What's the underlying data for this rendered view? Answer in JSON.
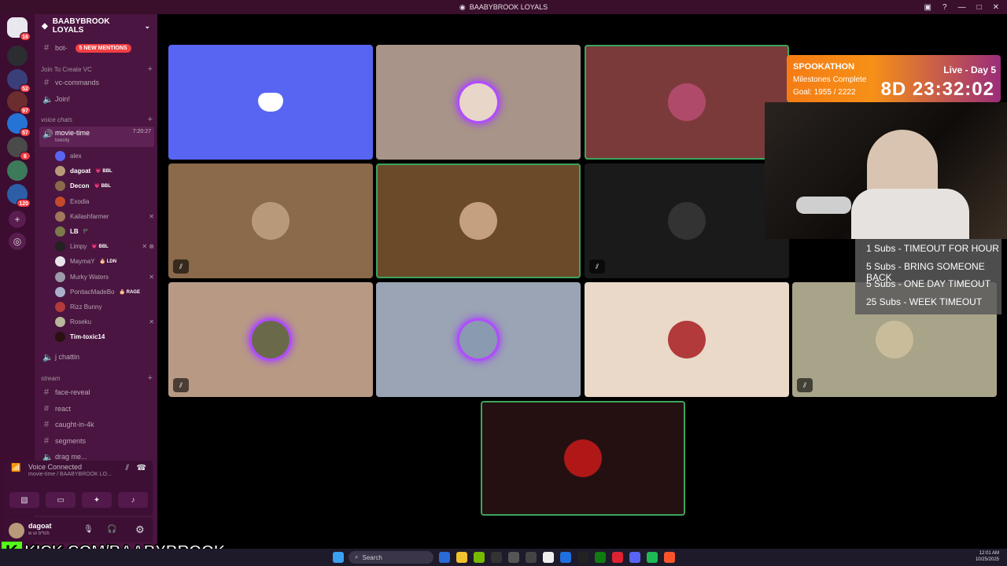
{
  "window": {
    "title": "BAABYBROOK LOYALS"
  },
  "rail": {
    "servers": [
      {
        "badge": "16",
        "color": "#e8e8ee"
      },
      {
        "badge": "",
        "color": "#2b2d31"
      },
      {
        "badge": "52",
        "color": "#3a3f7a"
      },
      {
        "badge": "97",
        "color": "#6b2d2d"
      },
      {
        "badge": "57",
        "color": "#2673d6"
      },
      {
        "badge": "6",
        "color": "#4a4a4a"
      },
      {
        "badge": "",
        "color": "#3c7a5a"
      },
      {
        "badge": "120",
        "color": "#2c5fa8"
      }
    ]
  },
  "sidebar": {
    "server_name": "BAABYBROOK LOYALS",
    "bot_channel": "bot-",
    "mentions": "5 NEW MENTIONS",
    "cat_create": "Join To Create VC",
    "vc_commands": "vc-commands",
    "join": "Join!",
    "cat_voice": "voice chats",
    "movie_time": "movie-time",
    "movie_time_timer": "7:20:27",
    "movie_time_sub": "toxicity",
    "users": [
      {
        "name": "alex",
        "tag": "",
        "muted": "",
        "color": "#5865f2"
      },
      {
        "name": "dagoat",
        "tag": "💗 BBL",
        "muted": "",
        "color": "#b89a7a"
      },
      {
        "name": "Decon",
        "tag": "💗 BBL",
        "muted": "",
        "color": "#8a6a4a"
      },
      {
        "name": "Exodia",
        "tag": "",
        "muted": "",
        "color": "#c44a2a"
      },
      {
        "name": "Kailashfarmer",
        "tag": "",
        "muted": "✕",
        "color": "#a0785a"
      },
      {
        "name": "LB",
        "tag": "🏴",
        "muted": "",
        "color": "#7a7a4a"
      },
      {
        "name": "Limpy",
        "tag": "💗 BBL",
        "muted": "✕ ⊗",
        "color": "#222222"
      },
      {
        "name": "MaymaY",
        "tag": "🎂 LDN",
        "muted": "",
        "color": "#e9e4ea"
      },
      {
        "name": "Murky Waters",
        "tag": "",
        "muted": "✕",
        "color": "#9a9aaa"
      },
      {
        "name": "PontiacMadeBo",
        "tag": "🎂 RAGE",
        "muted": "",
        "color": "#aab0c8"
      },
      {
        "name": "Rizz Bunny",
        "tag": "",
        "muted": "",
        "color": "#b23a3a"
      },
      {
        "name": "Roseku",
        "tag": "",
        "muted": "✕",
        "color": "#b8b89a"
      },
      {
        "name": "Tim-toxic14",
        "tag": "",
        "muted": "",
        "color": "#2a1010"
      }
    ],
    "j_chattin": "j chattin",
    "cat_stream": "stream",
    "stream_channels": [
      "face-reveal",
      "react",
      "caught-in-4k",
      "segments",
      "drag me..."
    ]
  },
  "voice_panel": {
    "status": "Voice Connected",
    "channel": "movie-time / BAABYBROOK LO..."
  },
  "user_panel": {
    "name": "dagoat",
    "status": "w ur b*tch"
  },
  "overlay_kick": {
    "url": "KICK.COM/BAABYBROOK"
  },
  "spookathon": {
    "title": "SPOOKATHON",
    "milestones": "Milestones Complete",
    "goal": "Goal: 1955 / 2222",
    "live": "Live - Day 5",
    "timer": "8D 23:32:02"
  },
  "subs_list": [
    "1 Subs - TIMEOUT FOR HOUR",
    "5 Subs - BRING SOMEONE BACK",
    "5 Subs - ONE DAY TIMEOUT",
    "25 Subs - WEEK TIMEOUT"
  ],
  "tiles": [
    {
      "bg": "#5865f2",
      "avatar": "discord",
      "speaking": false,
      "muted": false,
      "glow": false
    },
    {
      "bg": "#a89488",
      "avatar": "#e8d6c8",
      "speaking": false,
      "muted": false,
      "glow": true
    },
    {
      "bg": "#7a3a3a",
      "avatar": "#b04a6a",
      "speaking": true,
      "muted": false,
      "glow": false
    },
    {
      "bg": "#8a6a4a",
      "avatar": "#b89a7a",
      "speaking": false,
      "muted": true,
      "glow": false
    },
    {
      "bg": "#6b4a2a",
      "avatar": "#c4a080",
      "speaking": true,
      "muted": false,
      "glow": false
    },
    {
      "bg": "#1a1a1a",
      "avatar": "#333333",
      "speaking": false,
      "muted": true,
      "glow": false
    },
    {
      "bg": "#b89a84",
      "avatar": "#6a6a4a",
      "speaking": false,
      "muted": true,
      "glow": true
    },
    {
      "bg": "#9aa4b4",
      "avatar": "#8a9ab0",
      "speaking": false,
      "muted": false,
      "glow": true
    },
    {
      "bg": "#ead8c8",
      "avatar": "#b23a3a",
      "speaking": false,
      "muted": false,
      "glow": false
    },
    {
      "bg": "#a8a48a",
      "avatar": "#c8bc9a",
      "speaking": false,
      "muted": true,
      "glow": false
    },
    {
      "bg": "#241010",
      "avatar": "#b01818",
      "speaking": true,
      "muted": false,
      "glow": false
    }
  ],
  "taskbar": {
    "search": "Search",
    "time": "12:01 AM",
    "date": "10/25/2025"
  }
}
